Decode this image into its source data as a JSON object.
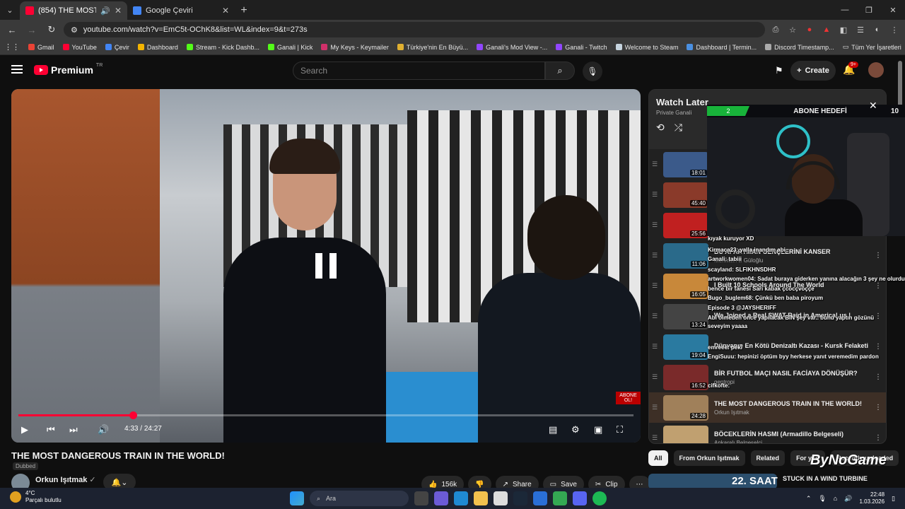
{
  "browser": {
    "tabs": [
      {
        "title": "(854) THE MOST DANGERO...",
        "active": true
      },
      {
        "title": "Google Çeviri",
        "active": false
      }
    ],
    "url": "youtube.com/watch?v=EmC5t-OChK8&list=WL&index=9&t=273s",
    "bookmarks": [
      "Gmail",
      "YouTube",
      "Çevir",
      "Dashboard",
      "Stream - Kick Dashb...",
      "Ganali | Kick",
      "My Keys - Keymailer",
      "Türkiye'nin En Büyü...",
      "Ganali's Mod View -...",
      "Ganali - Twitch",
      "Welcome to Steam",
      "Dashboard | Termin...",
      "Discord Timestamp..."
    ],
    "bookmarks_all": "Tüm Yer İşaretleri"
  },
  "yt": {
    "brand": "Premium",
    "region": "TR",
    "search_placeholder": "Search",
    "create_label": "Create",
    "notif_badge": "9+"
  },
  "player": {
    "current_time": "4:33",
    "duration": "24:27",
    "progress": 0.186,
    "overlay_badge": "ABONE OL!"
  },
  "video": {
    "title": "THE MOST DANGEROUS TRAIN IN THE WORLD!",
    "dubbed": "Dubbed",
    "channel": "Orkun Işıtmak",
    "likes": "156k",
    "share": "Share",
    "save": "Save",
    "clip": "Clip"
  },
  "watch_later": {
    "title": "Watch Later",
    "subtitle": "Private  Ganali",
    "items": [
      {
        "title": "",
        "channel": "",
        "duration": "18:01",
        "color": "#3b5a8a"
      },
      {
        "title": "",
        "channel": "",
        "duration": "45:40",
        "color": "#8a3a2a"
      },
      {
        "title": "",
        "channel": "",
        "duration": "25:56",
        "color": "#c02020"
      },
      {
        "title": "BU APARTMAN GENÇLERİNİ KANSER",
        "channel": "Mehmet Ali Güloğlu",
        "duration": "11:06",
        "color": "#2a6a8a"
      },
      {
        "title": "I Built 10 Schools Around The World",
        "channel": "",
        "duration": "16:05",
        "color": "#c8883a"
      },
      {
        "title": "We Joined a Real SWAT Raid in America! us |",
        "channel": "",
        "duration": "13:24",
        "color": "#444"
      },
      {
        "title": "Dünyanın En Kötü Denizaltı Kazası - Kursk Felaketi",
        "channel": "",
        "duration": "19:04",
        "color": "#2a7aa0"
      },
      {
        "title": "BİR FUTBOL MAÇI NASIL FACİAYA DÖNÜŞÜR?",
        "channel": "gentropi",
        "duration": "16:52",
        "color": "#7a2a2a"
      },
      {
        "title": "THE MOST DANGEROUS TRAIN IN THE WORLD!",
        "channel": "Orkun Işıtmak",
        "duration": "24:28",
        "color": "#a0805a"
      },
      {
        "title": "BÖCEKLERİN HASMI (Armadillo Belgeseli)",
        "channel": "Ankaralı Belgeselci",
        "duration": "",
        "color": "#c0a070"
      }
    ]
  },
  "stream_overlay": {
    "goal_current": "2",
    "goal_label": "ABONE HEDEFİ",
    "goal_target": "10"
  },
  "chat": [
    {
      "text": "kıyak kuruyor XD"
    },
    {
      "text": "Kirmaca23: yalla inandım abi"
    },
    {
      "text": "Ganali: tabiii"
    },
    {
      "text": "scayland: SLFIKHNSDHR"
    },
    {
      "text": "artworkwomen04: Sadat buraya giderken yanına alacağın 3 şey ne olurdu"
    },
    {
      "text": "bence bir tanesi Sarı kabak çcöcçvöççe"
    },
    {
      "text": "Bugo_buglem68: Çünkü ben baba piroyum"
    },
    {
      "text": "Episode 3 @JAYSHERIFF"
    },
    {
      "text": "Abi olmeden once yapilacak BIN şey var.. bunu yaptın gözünü"
    },
    {
      "text": "seveyim yaaaa"
    },
    {
      "text": "emreee: peki"
    },
    {
      "text": "EngiSuuu: hepinizi öptüm byy herkese yanıt veremedim pardon"
    },
    {
      "text": "cifkofte:"
    }
  ],
  "chips": [
    "All",
    "From Orkun Işıtmak",
    "Related",
    "For you",
    "Recently uploaded"
  ],
  "watermark": "ByNoGame",
  "next_video": {
    "title": "STUCK IN A WIND TURBINE",
    "thumb_text": "22. SAAT"
  },
  "taskbar": {
    "temp": "4°C",
    "weather": "Parçalı bulutlu",
    "search": "Ara",
    "time": "22:48",
    "date": "1.03.2026"
  }
}
